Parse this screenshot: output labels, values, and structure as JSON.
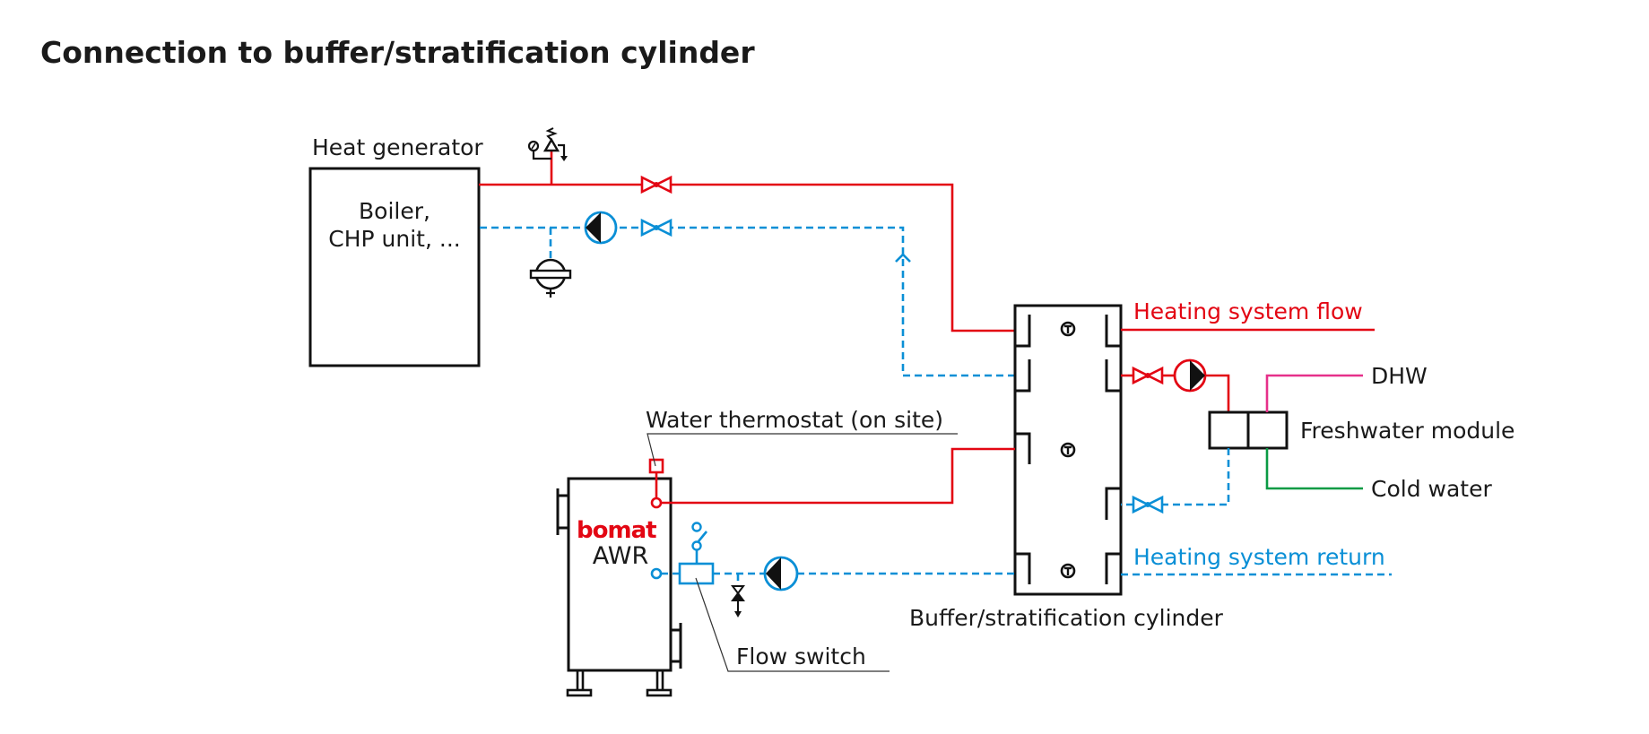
{
  "title": "Connection to buffer/stratification cylinder",
  "colors": {
    "flow": "#e30613",
    "return": "#0a8fd6",
    "dhw": "#e6308a",
    "cold_water": "#0a9a44",
    "outline": "#111111"
  },
  "components": {
    "heat_generator": {
      "label": "Heat generator",
      "content_line1": "Boiler,",
      "content_line2": "CHP unit, ..."
    },
    "buffer_cylinder": {
      "label": "Buffer/stratification cylinder"
    },
    "awr": {
      "brand": "bomat",
      "model": "AWR"
    },
    "freshwater_module": {
      "label": "Freshwater module"
    },
    "water_thermostat": {
      "label": "Water thermostat (on site)"
    },
    "flow_switch": {
      "label": "Flow switch"
    }
  },
  "connections": {
    "heating_system_flow": "Heating system flow",
    "heating_system_return": "Heating system return",
    "dhw": "DHW",
    "cold_water": "Cold water"
  },
  "icons": [
    "safety-group-icon",
    "shutoff-valve-icon",
    "circulation-pump-icon",
    "expansion-vessel-icon",
    "temperature-sensor-icon",
    "drain-valve-icon",
    "flow-switch-contact-icon"
  ]
}
